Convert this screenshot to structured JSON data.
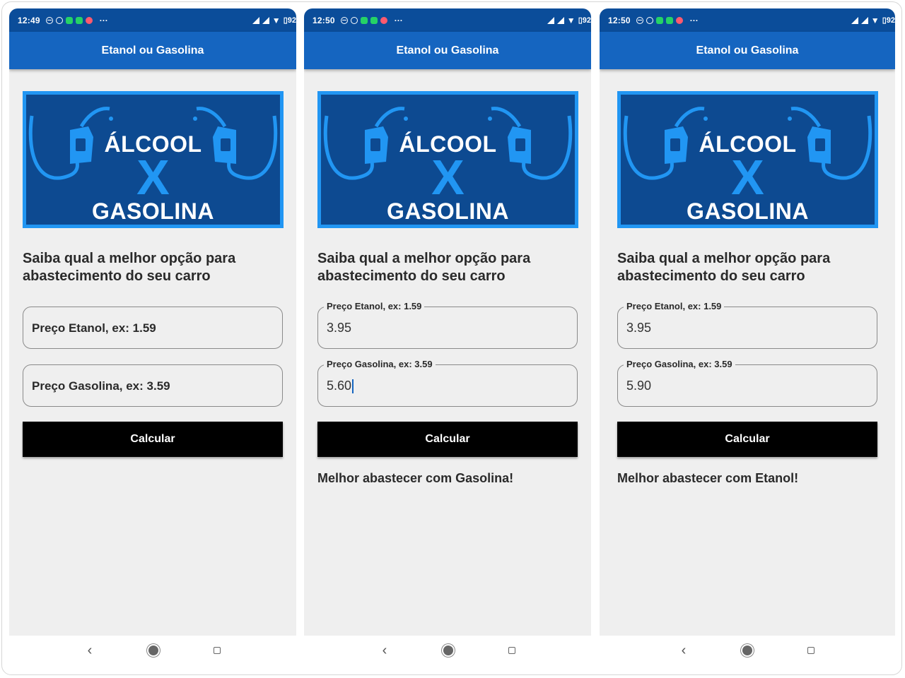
{
  "screens": [
    {
      "status": {
        "time": "12:49",
        "battery": "92"
      },
      "appbar_title": "Etanol ou Gasolina",
      "banner": {
        "line1": "ÁLCOOL",
        "x": "X",
        "line2": "GASOLINA"
      },
      "subtitle": "Saiba qual a melhor opção para abastecimento do seu carro",
      "etanol": {
        "label": "Preço Etanol, ex: 1.59",
        "value": ""
      },
      "gasolina": {
        "label": "Preço Gasolina, ex: 3.59",
        "value": ""
      },
      "button": "Calcular",
      "result": ""
    },
    {
      "status": {
        "time": "12:50",
        "battery": "92"
      },
      "appbar_title": "Etanol ou Gasolina",
      "banner": {
        "line1": "ÁLCOOL",
        "x": "X",
        "line2": "GASOLINA"
      },
      "subtitle": "Saiba qual a melhor opção para abastecimento do seu carro",
      "etanol": {
        "label": "Preço Etanol, ex: 1.59",
        "value": "3.95"
      },
      "gasolina": {
        "label": "Preço Gasolina, ex: 3.59",
        "value": "5.60"
      },
      "button": "Calcular",
      "result": "Melhor abastecer com Gasolina!"
    },
    {
      "status": {
        "time": "12:50",
        "battery": "92"
      },
      "appbar_title": "Etanol ou Gasolina",
      "banner": {
        "line1": "ÁLCOOL",
        "x": "X",
        "line2": "GASOLINA"
      },
      "subtitle": "Saiba qual a melhor opção para abastecimento do seu carro",
      "etanol": {
        "label": "Preço Etanol, ex: 1.59",
        "value": "3.95"
      },
      "gasolina": {
        "label": "Preço Gasolina, ex: 3.59",
        "value": "5.90"
      },
      "button": "Calcular",
      "result": "Melhor abastecer com Etanol!"
    }
  ],
  "colors": {
    "statusbar": "#0b4d9a",
    "appbar": "#1565c0",
    "banner_bg": "#0d4a91",
    "banner_accent": "#2196f3",
    "button": "#000000"
  },
  "icons": [
    "do-not-disturb-icon",
    "alarm-icon",
    "whatsapp-icon",
    "whatsapp-icon",
    "message-icon",
    "signal-icon",
    "wifi-icon",
    "battery-icon",
    "fuel-pump-icon",
    "back-icon",
    "home-icon",
    "recent-apps-icon"
  ]
}
